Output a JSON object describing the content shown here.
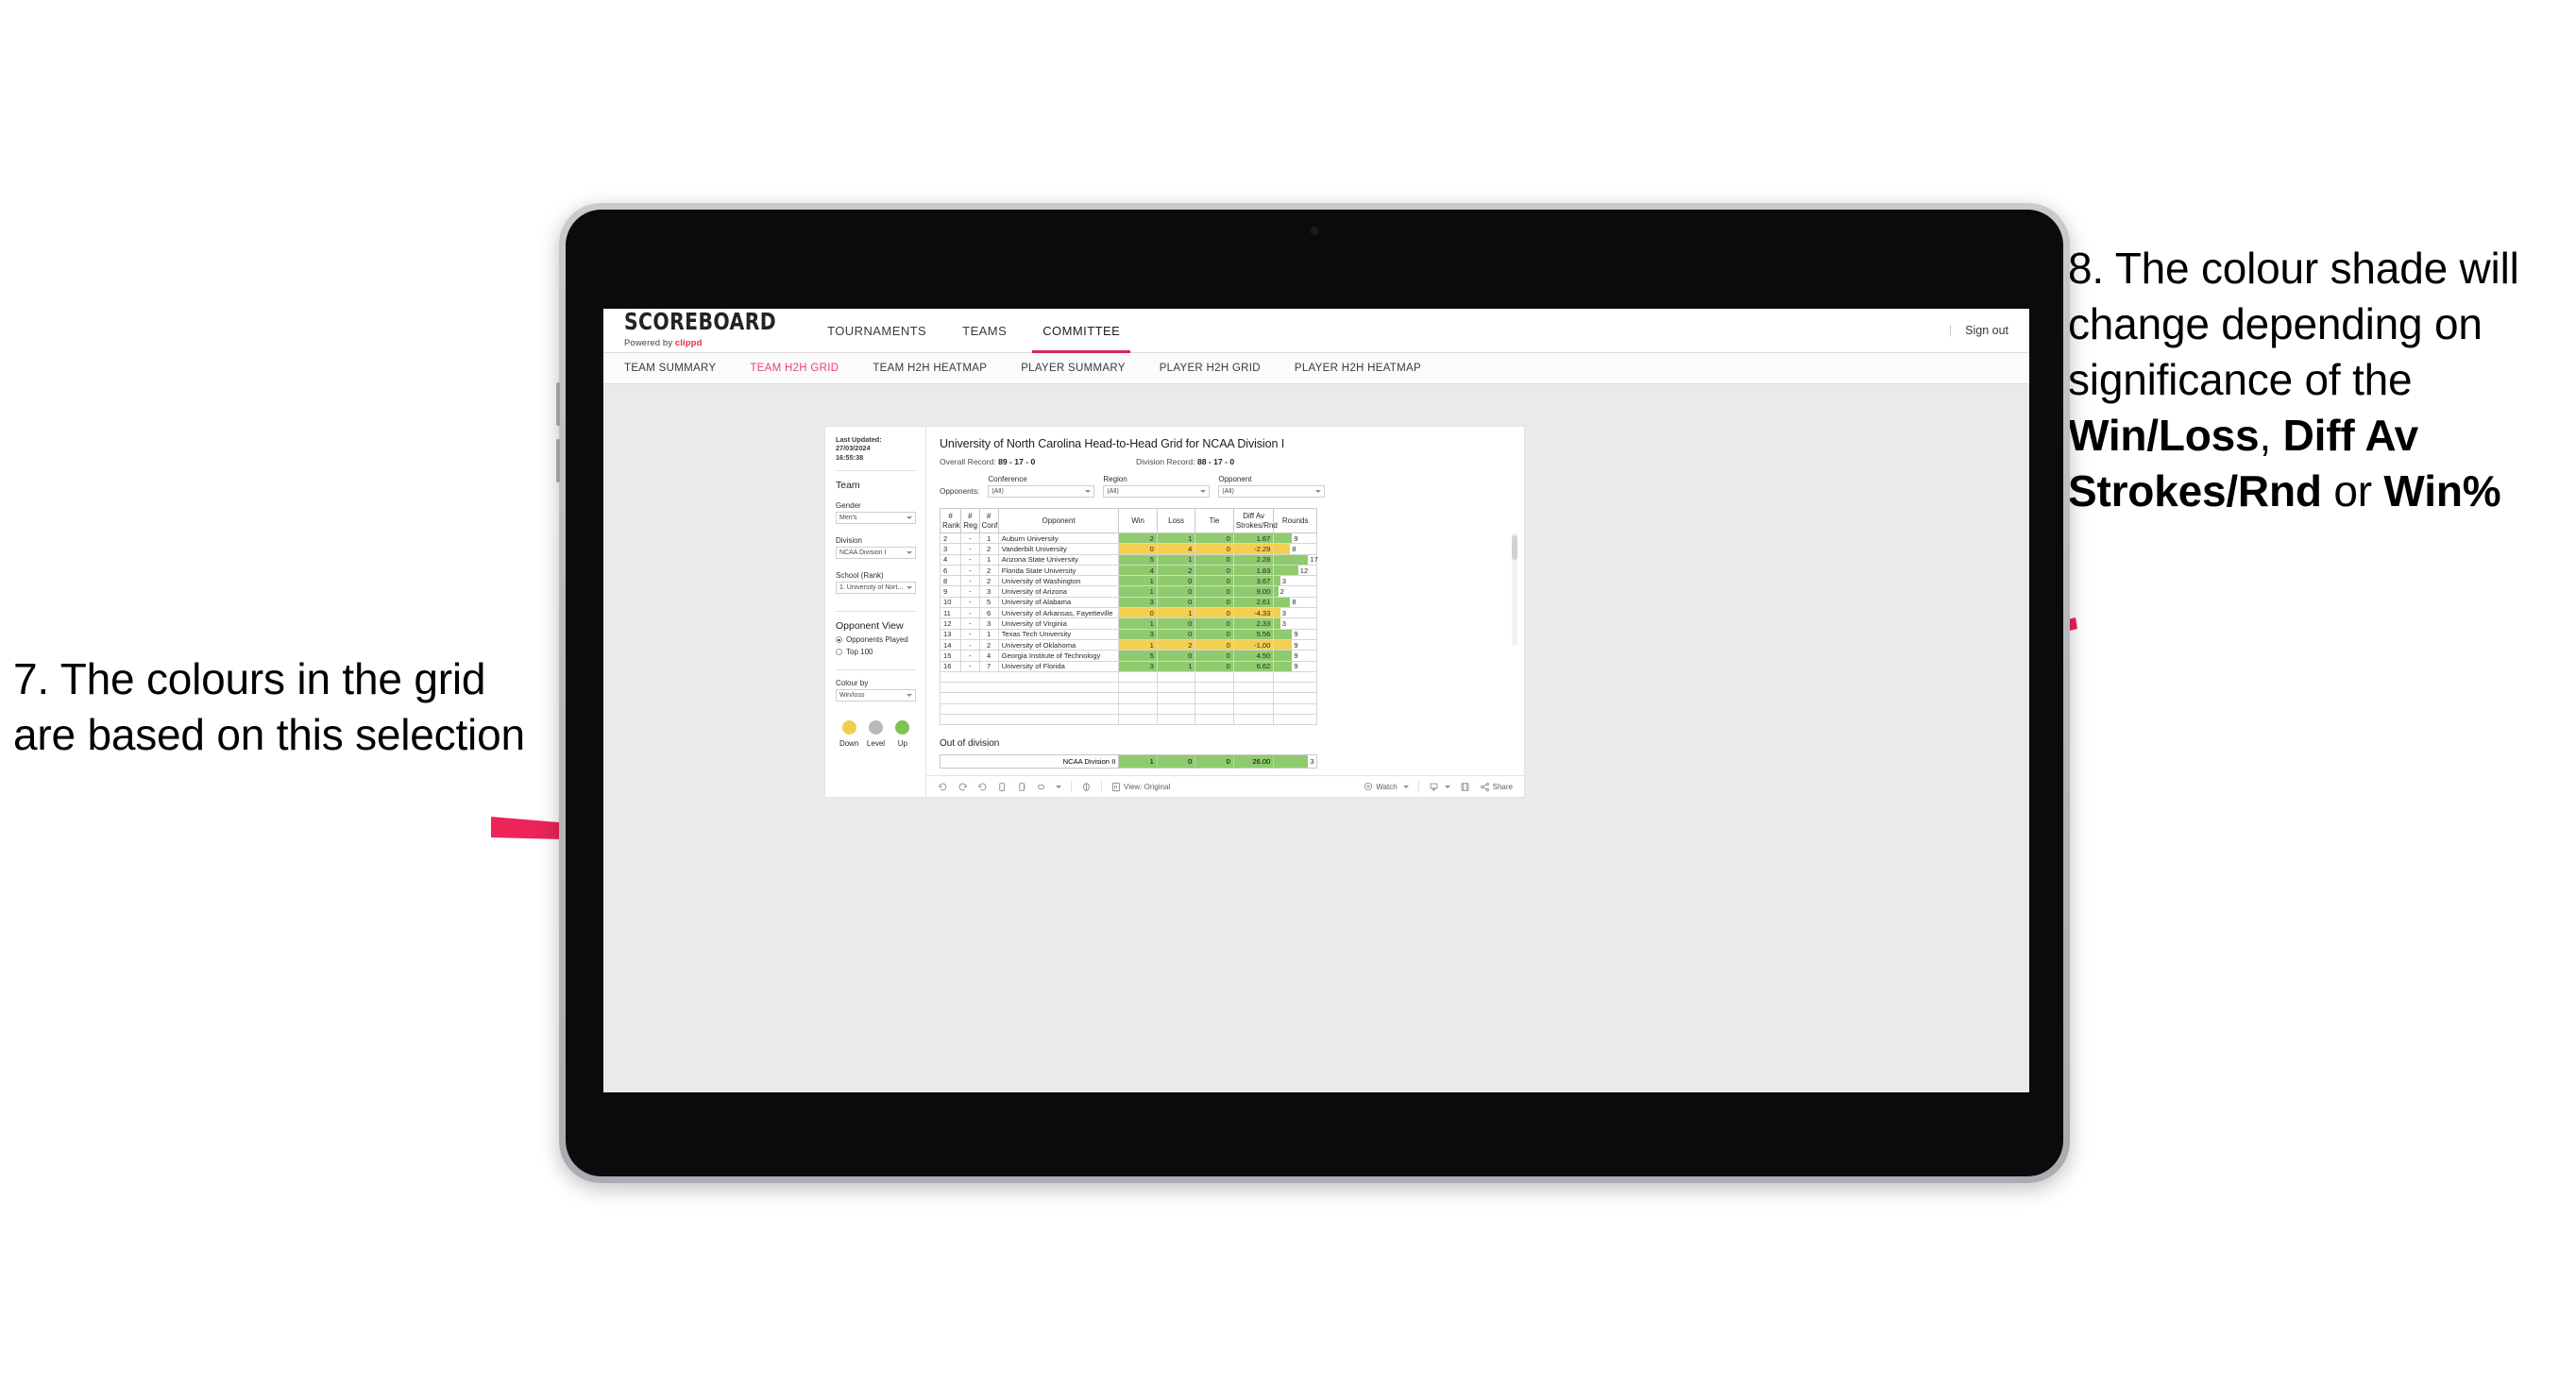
{
  "annotations": {
    "left": {
      "text": "7. The colours in the grid are based on this selection"
    },
    "right": {
      "prefix": "8. The colour shade will change depending on significance of the ",
      "bold1": "Win/Loss",
      "mid1": ", ",
      "bold2": "Diff Av Strokes/Rnd",
      "mid2": " or ",
      "bold3": "Win%"
    },
    "arrow_color": "#ec2458"
  },
  "app": {
    "brand": {
      "word": "SCOREBOARD",
      "powered_by": "Powered by",
      "clippd": "clippd"
    },
    "topnav": [
      {
        "label": "TOURNAMENTS",
        "active": false
      },
      {
        "label": "TEAMS",
        "active": false
      },
      {
        "label": "COMMITTEE",
        "active": true
      }
    ],
    "signout": {
      "divider": "|",
      "label": "Sign out"
    },
    "subnav": [
      {
        "label": "TEAM SUMMARY",
        "active": false
      },
      {
        "label": "TEAM H2H GRID",
        "active": true
      },
      {
        "label": "TEAM H2H HEATMAP",
        "active": false
      },
      {
        "label": "PLAYER SUMMARY",
        "active": false
      },
      {
        "label": "PLAYER H2H GRID",
        "active": false
      },
      {
        "label": "PLAYER H2H HEATMAP",
        "active": false
      }
    ]
  },
  "panel": {
    "last_updated_label": "Last Updated: 27/03/2024",
    "last_updated_time": "16:55:38",
    "team_heading": "Team",
    "fields": [
      {
        "label": "Gender",
        "value": "Men's"
      },
      {
        "label": "Division",
        "value": "NCAA Division I"
      },
      {
        "label": "School (Rank)",
        "value": "1. University of Nort..."
      }
    ],
    "opponent_view_heading": "Opponent View",
    "opponent_view_options": [
      {
        "label": "Opponents Played",
        "selected": true
      },
      {
        "label": "Top 100",
        "selected": false
      }
    ],
    "colour_by_label": "Colour by",
    "colour_by_value": "Win/loss",
    "legend": [
      {
        "label": "Down",
        "color": "#f0cf4e"
      },
      {
        "label": "Level",
        "color": "#b8b8bd"
      },
      {
        "label": "Up",
        "color": "#7cc254"
      }
    ]
  },
  "viz": {
    "title": "University of North Carolina Head-to-Head Grid for NCAA Division I",
    "overall_record_label": "Overall Record:",
    "overall_record_value": "89 - 17 - 0",
    "division_record_label": "Division Record:",
    "division_record_value": "88 - 17 - 0",
    "opponents_label": "Opponents:",
    "filters": [
      {
        "caption": "Conference",
        "value": "(All)"
      },
      {
        "caption": "Region",
        "value": "(All)"
      },
      {
        "caption": "Opponent",
        "value": "(All)"
      }
    ],
    "columns": [
      {
        "line1": "#",
        "line2": "Rank"
      },
      {
        "line1": "#",
        "line2": "Reg"
      },
      {
        "line1": "#",
        "line2": "Conf"
      },
      {
        "line1": "Opponent",
        "line2": ""
      },
      {
        "line1": "Win",
        "line2": ""
      },
      {
        "line1": "Loss",
        "line2": ""
      },
      {
        "line1": "Tie",
        "line2": ""
      },
      {
        "line1": "Diff Av",
        "line2": "Strokes/Rnd"
      },
      {
        "line1": "Rounds",
        "line2": ""
      }
    ],
    "rounds_max": 17,
    "rows": [
      {
        "rank": "2",
        "reg": "-",
        "conf": "1",
        "opponent": "Auburn University",
        "win": "2",
        "loss": "1",
        "tie": "0",
        "diff": "1.67",
        "rounds": "9",
        "state": "up"
      },
      {
        "rank": "3",
        "reg": "-",
        "conf": "2",
        "opponent": "Vanderbilt University",
        "win": "0",
        "loss": "4",
        "tie": "0",
        "diff": "-2.29",
        "rounds": "8",
        "state": "down"
      },
      {
        "rank": "4",
        "reg": "-",
        "conf": "1",
        "opponent": "Arizona State University",
        "win": "5",
        "loss": "1",
        "tie": "0",
        "diff": "2.28",
        "rounds": "17",
        "state": "up"
      },
      {
        "rank": "6",
        "reg": "-",
        "conf": "2",
        "opponent": "Florida State University",
        "win": "4",
        "loss": "2",
        "tie": "0",
        "diff": "1.83",
        "rounds": "12",
        "state": "up"
      },
      {
        "rank": "8",
        "reg": "-",
        "conf": "2",
        "opponent": "University of Washington",
        "win": "1",
        "loss": "0",
        "tie": "0",
        "diff": "3.67",
        "rounds": "3",
        "state": "up"
      },
      {
        "rank": "9",
        "reg": "-",
        "conf": "3",
        "opponent": "University of Arizona",
        "win": "1",
        "loss": "0",
        "tie": "0",
        "diff": "9.00",
        "rounds": "2",
        "state": "up"
      },
      {
        "rank": "10",
        "reg": "-",
        "conf": "5",
        "opponent": "University of Alabama",
        "win": "3",
        "loss": "0",
        "tie": "0",
        "diff": "2.61",
        "rounds": "8",
        "state": "up"
      },
      {
        "rank": "11",
        "reg": "-",
        "conf": "6",
        "opponent": "University of Arkansas, Fayetteville",
        "win": "0",
        "loss": "1",
        "tie": "0",
        "diff": "-4.33",
        "rounds": "3",
        "state": "down"
      },
      {
        "rank": "12",
        "reg": "-",
        "conf": "3",
        "opponent": "University of Virginia",
        "win": "1",
        "loss": "0",
        "tie": "0",
        "diff": "2.33",
        "rounds": "3",
        "state": "up"
      },
      {
        "rank": "13",
        "reg": "-",
        "conf": "1",
        "opponent": "Texas Tech University",
        "win": "3",
        "loss": "0",
        "tie": "0",
        "diff": "5.56",
        "rounds": "9",
        "state": "up"
      },
      {
        "rank": "14",
        "reg": "-",
        "conf": "2",
        "opponent": "University of Oklahoma",
        "win": "1",
        "loss": "2",
        "tie": "0",
        "diff": "-1.00",
        "rounds": "9",
        "state": "down"
      },
      {
        "rank": "15",
        "reg": "-",
        "conf": "4",
        "opponent": "Georgia Institute of Technology",
        "win": "5",
        "loss": "0",
        "tie": "0",
        "diff": "4.50",
        "rounds": "9",
        "state": "up"
      },
      {
        "rank": "16",
        "reg": "-",
        "conf": "7",
        "opponent": "University of Florida",
        "win": "3",
        "loss": "1",
        "tie": "0",
        "diff": "6.62",
        "rounds": "9",
        "state": "up"
      }
    ],
    "out_of_division": {
      "title": "Out of division",
      "row": {
        "name": "NCAA Division II",
        "win": "1",
        "loss": "0",
        "tie": "0",
        "diff": "26.00",
        "rounds": "3",
        "state": "up"
      }
    },
    "toolbar": {
      "view_label": "View: Original",
      "watch_label": "Watch",
      "share_label": "Share"
    },
    "colors": {
      "up": "#8fcb6e",
      "down": "#f3cf52",
      "level": "#b8b8bd"
    }
  }
}
